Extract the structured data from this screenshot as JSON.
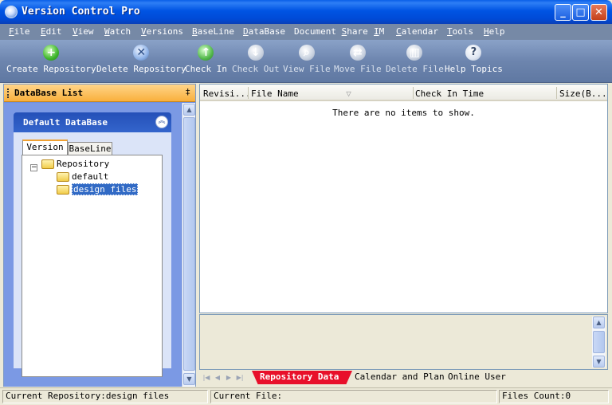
{
  "window": {
    "title": "Version Control Pro",
    "controls": [
      "_",
      "□",
      "✕"
    ]
  },
  "menu": [
    {
      "accel": "F",
      "rest": "ile"
    },
    {
      "accel": "E",
      "rest": "dit"
    },
    {
      "accel": "V",
      "rest": "iew"
    },
    {
      "accel": "W",
      "rest": "atch"
    },
    {
      "accel": "V",
      "rest": "ersions"
    },
    {
      "accel": "B",
      "rest": "aseLine"
    },
    {
      "accel": "D",
      "rest": "ataBase"
    },
    {
      "pre": "Document ",
      "accel": "S",
      "rest": "hare"
    },
    {
      "accel": "I",
      "rest": "M"
    },
    {
      "accel": "C",
      "rest": "alendar"
    },
    {
      "accel": "T",
      "rest": "ools"
    },
    {
      "accel": "H",
      "rest": "elp"
    }
  ],
  "toolbar": [
    {
      "label": "Create Repository",
      "icon": "add-icon",
      "enabled": true
    },
    {
      "label": "Delete Repository",
      "icon": "delete-icon",
      "enabled": true
    },
    {
      "label": "Check In",
      "icon": "check-in-icon",
      "enabled": true
    },
    {
      "label": "Check Out",
      "icon": "check-out-icon",
      "enabled": false
    },
    {
      "label": "View File",
      "icon": "view-file-icon",
      "enabled": false
    },
    {
      "label": "Move File",
      "icon": "move-file-icon",
      "enabled": false
    },
    {
      "label": "Delete File",
      "icon": "delete-file-icon",
      "enabled": false
    },
    {
      "label": "Help Topics",
      "icon": "help-icon",
      "enabled": true
    }
  ],
  "left_panel": {
    "title": "DataBase List",
    "pin_glyph": "‡",
    "database_title": "Default DataBase",
    "tabs": {
      "version": "Version",
      "baseline": "BaseLine"
    },
    "tree": {
      "expander": "−",
      "root": "Repository",
      "children": [
        "default",
        "design files"
      ],
      "selected": "design files"
    }
  },
  "grid": {
    "columns": [
      "Revisi...",
      "File Name",
      "Check In Time",
      "Size(B..."
    ],
    "sort_glyph": "▽",
    "empty_message": "There are no items to show."
  },
  "sheet_tabs": [
    "Repository Data",
    "Calendar and Plan",
    "Online User"
  ],
  "status": {
    "repository": "Current Repository:design files",
    "file": "Current File:",
    "count": "Files Count:0"
  },
  "colors": {
    "title_blue": "#0054e3",
    "menu_bg": "#7689a6",
    "panel_header": "#f9b03c",
    "active_tab": "#e8102a",
    "selection": "#316ac5"
  }
}
